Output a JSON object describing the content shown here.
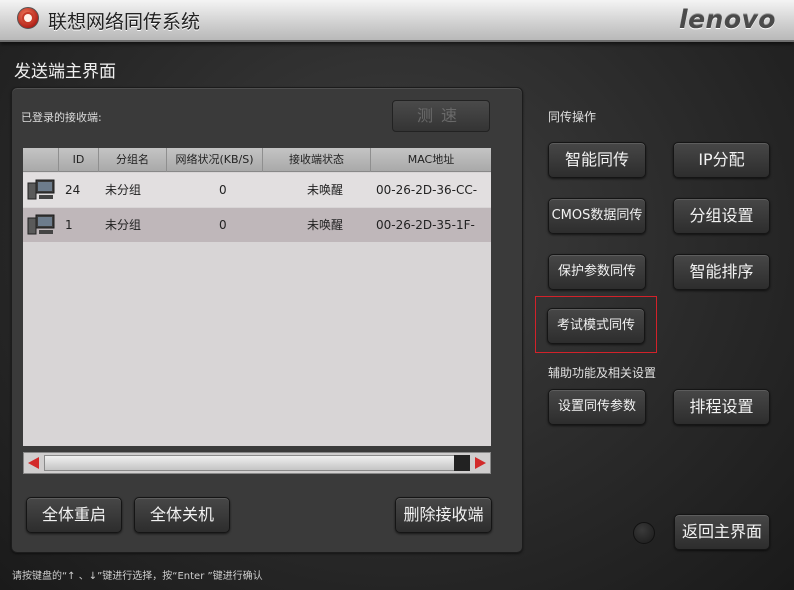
{
  "titlebar": {
    "title": "联想网络同传系统",
    "brand": "lenovo"
  },
  "page_title": "发送端主界面",
  "receivers": {
    "label": "已登录的接收端:",
    "speed_button": "测速",
    "columns": [
      "ID",
      "分组名",
      "网络状况(KB/S)",
      "接收端状态",
      "MAC地址"
    ],
    "rows": [
      {
        "id": "24",
        "group": "未分组",
        "network": "0",
        "status": "未唤醒",
        "mac": "00-26-2D-36-CC-"
      },
      {
        "id": "1",
        "group": "未分组",
        "network": "0",
        "status": "未唤醒",
        "mac": "00-26-2D-35-1F-"
      }
    ]
  },
  "bottom_buttons": {
    "restart_all": "全体重启",
    "shutdown_all": "全体关机",
    "delete_receiver": "删除接收端"
  },
  "sync_ops": {
    "label": "同传操作",
    "smart_sync": "智能同传",
    "ip_assign": "IP分配",
    "cmos_sync": "CMOS数据同传",
    "group_settings": "分组设置",
    "protect_param_sync": "保护参数同传",
    "smart_sort": "智能排序",
    "exam_mode_sync": "考试模式同传"
  },
  "aux": {
    "label": "辅助功能及相关设置",
    "set_sync_params": "设置同传参数",
    "schedule_settings": "排程设置"
  },
  "return_button": "返回主界面",
  "hint": "请按键盘的“↑ 、↓”键进行选择，按“Enter ”键进行确认",
  "colors": {
    "highlight": "#d2222a",
    "scroll_arrow": "#d22a2a"
  }
}
